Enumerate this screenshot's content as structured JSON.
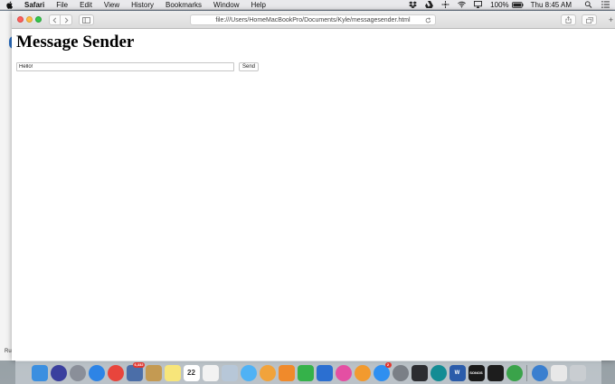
{
  "menubar": {
    "app_name": "Safari",
    "items": [
      "File",
      "Edit",
      "View",
      "History",
      "Bookmarks",
      "Window",
      "Help"
    ],
    "battery": "100%",
    "clock": "Thu 8:45 AM"
  },
  "browser": {
    "url": "file:///Users/HomeMacBookPro/Documents/Kyle/messagesender.html",
    "new_tab_symbol": "+"
  },
  "page": {
    "title": "Message Sender",
    "message_input_value": "Hello!",
    "send_label": "Send"
  },
  "background_window": {
    "edge_text": "Ru"
  },
  "dock": {
    "items": [
      {
        "name": "finder",
        "color": "#3b8fe0"
      },
      {
        "name": "siri",
        "color": "#3a3f9e"
      },
      {
        "name": "launchpad",
        "color": "#8a8f99"
      },
      {
        "name": "safari",
        "color": "#2d84e6"
      },
      {
        "name": "chrome",
        "color": "#e8453c"
      },
      {
        "name": "photo-library",
        "color": "#4b6ea8",
        "badge": "6,332"
      },
      {
        "name": "notefile",
        "color": "#c49a52"
      },
      {
        "name": "notes",
        "color": "#f7e57a"
      },
      {
        "name": "calendar",
        "color": "#ffffff",
        "label": "22"
      },
      {
        "name": "reminders",
        "color": "#f2f2f2"
      },
      {
        "name": "preview",
        "color": "#b7c7d8"
      },
      {
        "name": "messages",
        "color": "#4fb2f5"
      },
      {
        "name": "photos",
        "color": "#f1a33b"
      },
      {
        "name": "pages",
        "color": "#f08a2b"
      },
      {
        "name": "numbers",
        "color": "#35b24a"
      },
      {
        "name": "keynote",
        "color": "#2b6fd1"
      },
      {
        "name": "itunes",
        "color": "#e44fa3"
      },
      {
        "name": "ibooks",
        "color": "#f29a2e"
      },
      {
        "name": "app-store",
        "color": "#2f8ff0",
        "badge": "2"
      },
      {
        "name": "system-preferences",
        "color": "#7a7f86"
      },
      {
        "name": "slack",
        "color": "#2c2d31"
      },
      {
        "name": "arduino",
        "color": "#138c94"
      },
      {
        "name": "word",
        "color": "#2b5caa",
        "label": "W"
      },
      {
        "name": "sonos",
        "color": "#1a1a1a",
        "label": "SONOS"
      },
      {
        "name": "terminal",
        "color": "#1d1d1d"
      },
      {
        "name": "update-app",
        "color": "#3aa34a"
      },
      {
        "name": "downloads",
        "color": "#3a7fcf"
      },
      {
        "name": "documents",
        "color": "#e8e8e8"
      },
      {
        "name": "trash",
        "color": "#c9cdd1"
      }
    ]
  }
}
